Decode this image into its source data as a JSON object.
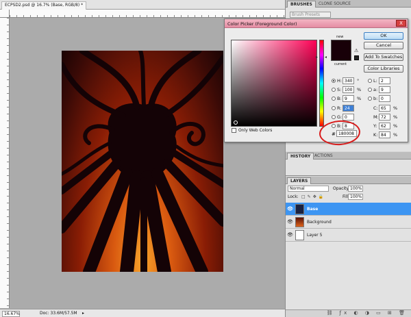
{
  "document": {
    "tab_title": "ECPSD2.psd @ 16.7% (Base, RGB/8) *",
    "zoom": "16.67%",
    "doc_info": "Doc: 33.6M/57.5M"
  },
  "panels": {
    "top_tabs": [
      "BRUSHES",
      "CLONE SOURCE"
    ],
    "brush_preset": "Brush Presets",
    "history_tabs": [
      "HISTORY",
      "ACTIONS"
    ],
    "layers_tabs": [
      "LAYERS"
    ],
    "blend_mode": "Normal",
    "opacity_label": "Opacity:",
    "opacity_value": "100%",
    "lock_label": "Lock:",
    "fill_label": "Fill:",
    "fill_value": "100%",
    "layers": [
      {
        "name": "Base",
        "selected": true
      },
      {
        "name": "Background",
        "selected": false
      },
      {
        "name": "Layer 5",
        "selected": false
      }
    ]
  },
  "color_picker": {
    "title": "Color Picker (Foreground Color)",
    "close": "X",
    "new_label": "new",
    "current_label": "current",
    "only_web_colors": "Only Web Colors",
    "buttons": {
      "ok": "OK",
      "cancel": "Cancel",
      "add_to_swatches": "Add To Swatches",
      "color_libraries": "Color Libraries"
    },
    "hsb": {
      "h_label": "H:",
      "h_value": "340",
      "h_unit": "°",
      "s_label": "S:",
      "s_value": "100",
      "s_unit": "%",
      "b_label": "B:",
      "b_value": "9",
      "b_unit": "%"
    },
    "rgb": {
      "r_label": "R:",
      "r_value": "24",
      "g_label": "G:",
      "g_value": "0",
      "b_label": "B:",
      "b_value": "8"
    },
    "lab": {
      "l_label": "L:",
      "l_value": "2",
      "a_label": "a:",
      "a_value": "9",
      "b_label": "b:",
      "b_value": "0"
    },
    "cmyk": {
      "c_label": "C:",
      "c_value": "65",
      "c_unit": "%",
      "m_label": "M:",
      "m_value": "72",
      "m_unit": "%",
      "y_label": "Y:",
      "y_value": "62",
      "y_unit": "%",
      "k_label": "K:",
      "k_value": "84",
      "k_unit": "%"
    },
    "hex_label": "#",
    "hex_value": "180008"
  },
  "colors": {
    "foreground": "#180008",
    "selected_layer": "#3d95f2",
    "annotation_circle": "#d81b1b"
  }
}
